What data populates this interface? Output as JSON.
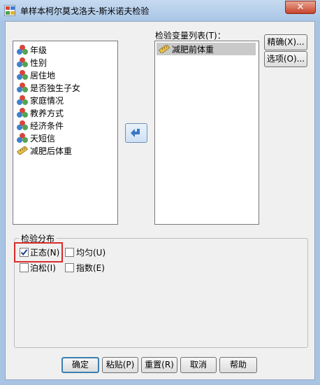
{
  "window": {
    "title": "单样本柯尔莫戈洛夫-斯米诺夫检验",
    "close_glyph": "✕"
  },
  "source_list": {
    "items": [
      {
        "label": "年级",
        "icon": "nominal-variable-icon"
      },
      {
        "label": "性别",
        "icon": "nominal-variable-icon"
      },
      {
        "label": "居住地",
        "icon": "nominal-variable-icon"
      },
      {
        "label": "是否独生子女",
        "icon": "nominal-variable-icon"
      },
      {
        "label": "家庭情况",
        "icon": "nominal-variable-icon"
      },
      {
        "label": "教养方式",
        "icon": "nominal-variable-icon"
      },
      {
        "label": "经济条件",
        "icon": "nominal-variable-icon"
      },
      {
        "label": "天短信",
        "icon": "nominal-variable-icon"
      },
      {
        "label": "减肥后体重",
        "icon": "scale-variable-icon"
      }
    ]
  },
  "test_list": {
    "label": "检验变量列表(T)：",
    "items": [
      {
        "label": "减肥前体重",
        "icon": "scale-variable-icon",
        "selected": true
      }
    ]
  },
  "side_buttons": {
    "exact": "精确(X)...",
    "options": "选项(O)..."
  },
  "distribution": {
    "legend": "检验分布",
    "normal": {
      "label": "正态(N)",
      "checked": true
    },
    "uniform": {
      "label": "均匀(U)",
      "checked": false
    },
    "poisson": {
      "label": "泊松(I)",
      "checked": false
    },
    "exponential": {
      "label": "指数(E)",
      "checked": false
    }
  },
  "bottom_buttons": {
    "ok": "确定",
    "paste": "粘贴(P)",
    "reset": "重置(R)",
    "cancel": "取消",
    "help": "帮助"
  },
  "colors": {
    "title_bar": "#aac6e6",
    "dialog_bg": "#f0f0f0",
    "close_button": "#c7432c",
    "selection": "#c9c9c9",
    "highlight_box": "#d92b2b",
    "default_button_border": "#3c7fb1"
  }
}
